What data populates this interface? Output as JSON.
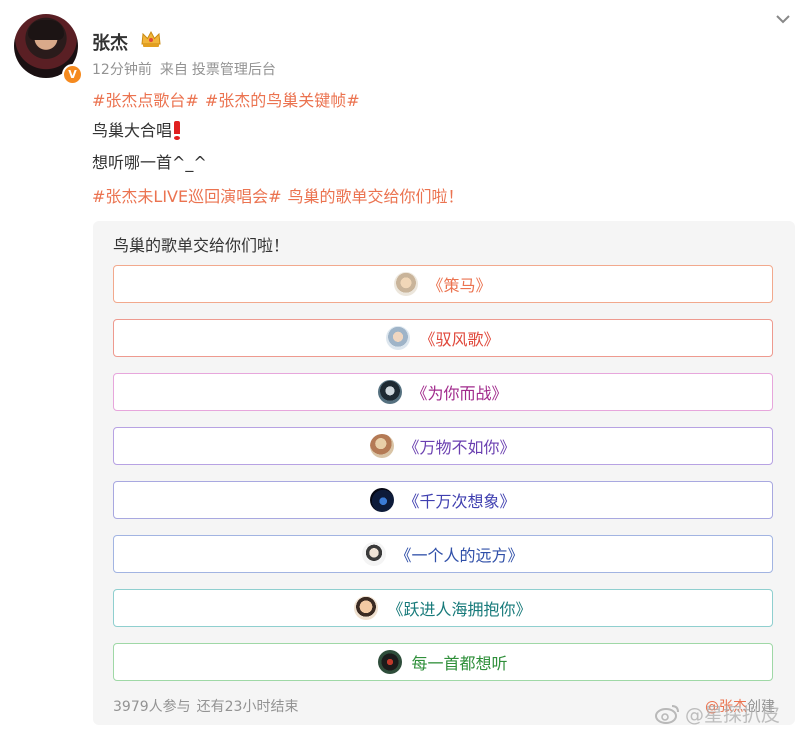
{
  "post": {
    "author": "张杰",
    "time": "12分钟前",
    "source_prefix": "来自",
    "source": "投票管理后台",
    "tags": [
      "#张杰点歌台#",
      "#张杰的鸟巢关键帧#"
    ],
    "line1": "鸟巢大合唱",
    "line2": "想听哪一首^_^",
    "line3_tag": "#张杰未LIVE巡回演唱会#",
    "line3_text": "鸟巢的歌单交给你们啦！"
  },
  "vote": {
    "title": "鸟巢的歌单交给你们啦！",
    "options": [
      {
        "label": "《策马》",
        "color": "#eb7350",
        "border": "#f2a98d"
      },
      {
        "label": "《驭风歌》",
        "color": "#e0483b",
        "border": "#ee9a8f"
      },
      {
        "label": "《为你而战》",
        "color": "#a12a8c",
        "border": "#e7a6dc"
      },
      {
        "label": "《万物不如你》",
        "color": "#6a3fb0",
        "border": "#b7a2e3"
      },
      {
        "label": "《千万次想象》",
        "color": "#3f3fb0",
        "border": "#a8a8e0"
      },
      {
        "label": "《一个人的远方》",
        "color": "#2f4fa8",
        "border": "#a2b4e2"
      },
      {
        "label": "《跃进人海拥抱你》",
        "color": "#177a7a",
        "border": "#8fcfcf"
      },
      {
        "label": "每一首都想听",
        "color": "#2f8f3a",
        "border": "#9fd8a6"
      }
    ],
    "participants": "3979人参与",
    "remaining": "还有23小时结束",
    "creator_at": "@张杰",
    "creator_suffix": "创建"
  },
  "watermark": "@星探扒皮",
  "icons": {
    "verified": "verified-v-icon",
    "crown": "crown-icon",
    "chevron": "chevron-down-icon",
    "weibo": "weibo-logo-icon"
  },
  "colors": {
    "link": "#eb7350",
    "meta": "#939393",
    "card_bg": "#f5f5f5",
    "verified": "#f58a1f"
  }
}
